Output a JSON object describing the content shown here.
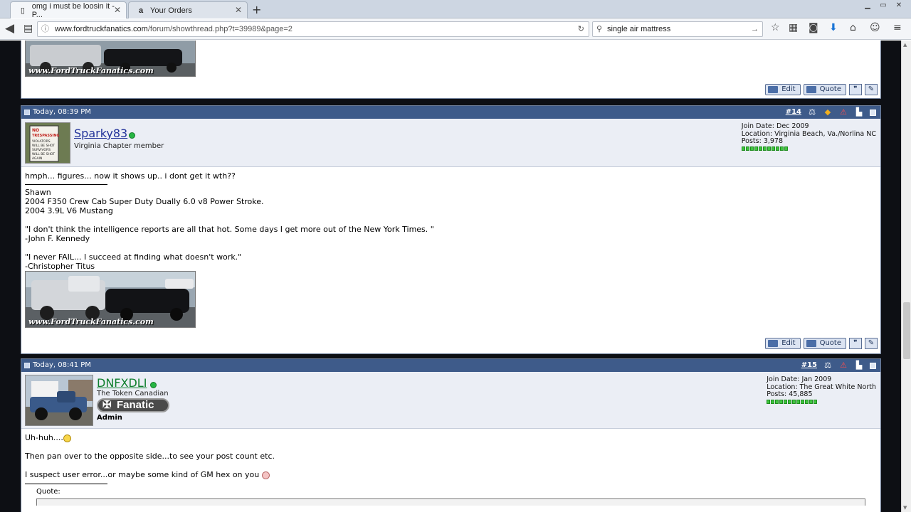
{
  "browser": {
    "tabs": [
      {
        "title": "omg i must be loosin it - P...",
        "icon": "page-icon",
        "active": true
      },
      {
        "title": "Your Orders",
        "icon": "amazon-icon",
        "active": false
      }
    ],
    "url_host": "www.fordtruckfanatics.com",
    "url_path": "/forum/showthread.php?t=39989&page=2",
    "search_value": "single air mattress"
  },
  "prev_post": {
    "watermark": "www.FordTruckFanatics.com",
    "edit_label": "Edit",
    "quote_label": "Quote"
  },
  "post14": {
    "date": "Today, 08:39 PM",
    "number": "#14",
    "username": "Sparky83",
    "usertitle": "Virginia Chapter member",
    "avatar_text": "NO TRESPASSING VIOLATORS WILL BE SHOT SURVIVORS WILL BE SHOT AGAIN",
    "join_date": "Join Date: Dec 2009",
    "location": "Location: Virginia Beach, Va./Norlina NC",
    "posts": "Posts: 3,978",
    "rep_pips": 11,
    "message": "hmph... figures... now it shows up.. i dont get it wth??",
    "sig_lines": [
      "Shawn",
      "2004 F350 Crew Cab Super Duty Dually 6.0 v8 Power Stroke.",
      "2004 3.9L V6 Mustang",
      "",
      "\"I don't think the intelligence reports are all that hot. Some days I get more out of the New York Times. \"",
      "-John F. Kennedy",
      "",
      "\"I never FAIL... I succeed at finding what doesn't work.\"",
      "-Christopher Titus"
    ],
    "watermark": "www.FordTruckFanatics.com",
    "edit_label": "Edit",
    "quote_label": "Quote"
  },
  "post15": {
    "date": "Today, 08:41 PM",
    "number": "#15",
    "username": "DNFXDLI",
    "usertitle": "The Token Canadian",
    "rank_label": "Fanatic",
    "role": "Admin",
    "join_date": "Join Date: Jan 2009",
    "location": "Location: The Great White North",
    "posts": "Posts: 45,885",
    "rep_pips": 12,
    "line1": "Uh-huh....",
    "line2": "Then pan over to the opposite side...to see your post count etc.",
    "line3": "I suspect user error...or maybe some kind of GM hex on you",
    "quote_label": "Quote:"
  }
}
